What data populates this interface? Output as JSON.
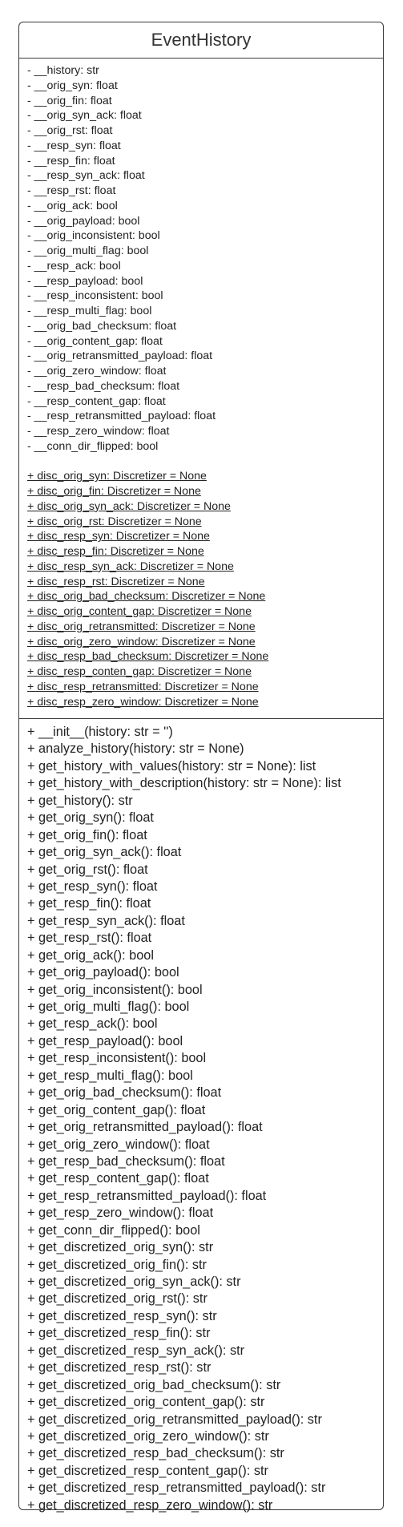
{
  "class_name": "EventHistory",
  "attributes": [
    "- __history: str",
    "- __orig_syn: float",
    "- __orig_fin: float",
    "- __orig_syn_ack: float",
    "- __orig_rst: float",
    "- __resp_syn: float",
    "- __resp_fin: float",
    "- __resp_syn_ack: float",
    "- __resp_rst: float",
    "- __orig_ack: bool",
    "- __orig_payload: bool",
    "- __orig_inconsistent: bool",
    "- __orig_multi_flag: bool",
    "- __resp_ack: bool",
    "- __resp_payload: bool",
    "- __resp_inconsistent: bool",
    "- __resp_multi_flag: bool",
    "- __orig_bad_checksum: float",
    "- __orig_content_gap: float",
    "- __orig_retransmitted_payload: float",
    "- __orig_zero_window: float",
    "- __resp_bad_checksum: float",
    "- __resp_content_gap: float",
    "- __resp_retransmitted_payload: float",
    "- __resp_zero_window: float",
    "- __conn_dir_flipped: bool"
  ],
  "static_attributes": [
    "+ disc_orig_syn: Discretizer = None",
    "+ disc_orig_fin: Discretizer = None",
    "+ disc_orig_syn_ack: Discretizer = None",
    "+ disc_orig_rst: Discretizer = None",
    "+ disc_resp_syn: Discretizer = None",
    "+ disc_resp_fin: Discretizer = None",
    "+ disc_resp_syn_ack: Discretizer = None",
    "+ disc_resp_rst: Discretizer = None",
    "+ disc_orig_bad_checksum: Discretizer = None",
    "+ disc_orig_content_gap: Discretizer = None",
    "+ disc_orig_retransmitted: Discretizer = None",
    "+ disc_orig_zero_window: Discretizer = None",
    "+ disc_resp_bad_checksum: Discretizer = None",
    "+ disc_resp_conten_gap: Discretizer = None",
    "+ disc_resp_retransmitted: Discretizer = None",
    "+ disc_resp_zero_window: Discretizer = None"
  ],
  "methods": [
    "+ __init__(history: str = '')",
    "+ analyze_history(history: str = None)",
    "+ get_history_with_values(history: str = None): list",
    "+ get_history_with_description(history: str = None): list",
    "+ get_history(): str",
    "+ get_orig_syn(): float",
    "+ get_orig_fin(): float",
    "+ get_orig_syn_ack(): float",
    "+ get_orig_rst(): float",
    "+ get_resp_syn(): float",
    "+ get_resp_fin(): float",
    "+ get_resp_syn_ack(): float",
    "+ get_resp_rst(): float",
    "+ get_orig_ack(): bool",
    "+ get_orig_payload(): bool",
    "+ get_orig_inconsistent(): bool",
    "+ get_orig_multi_flag(): bool",
    "+ get_resp_ack(): bool",
    "+ get_resp_payload(): bool",
    "+ get_resp_inconsistent(): bool",
    "+ get_resp_multi_flag(): bool",
    "+ get_orig_bad_checksum(): float",
    "+ get_orig_content_gap(): float",
    "+ get_orig_retransmitted_payload(): float",
    "+ get_orig_zero_window(): float",
    "+ get_resp_bad_checksum(): float",
    "+ get_resp_content_gap(): float",
    "+ get_resp_retransmitted_payload(): float",
    "+ get_resp_zero_window(): float",
    "+ get_conn_dir_flipped(): bool",
    "+ get_discretized_orig_syn(): str",
    "+ get_discretized_orig_fin(): str",
    "+ get_discretized_orig_syn_ack(): str",
    "+ get_discretized_orig_rst(): str",
    "+ get_discretized_resp_syn(): str",
    "+ get_discretized_resp_fin(): str",
    "+ get_discretized_resp_syn_ack(): str",
    "+ get_discretized_resp_rst(): str",
    "+ get_discretized_orig_bad_checksum(): str",
    "+ get_discretized_orig_content_gap(): str",
    "+ get_discretized_orig_retransmitted_payload(): str",
    "+ get_discretized_orig_zero_window(): str",
    "+ get_discretized_resp_bad_checksum(): str",
    "+ get_discretized_resp_content_gap(): str",
    "+ get_discretized_resp_retransmitted_payload(): str",
    "+ get_discretized_resp_zero_window(): str"
  ]
}
